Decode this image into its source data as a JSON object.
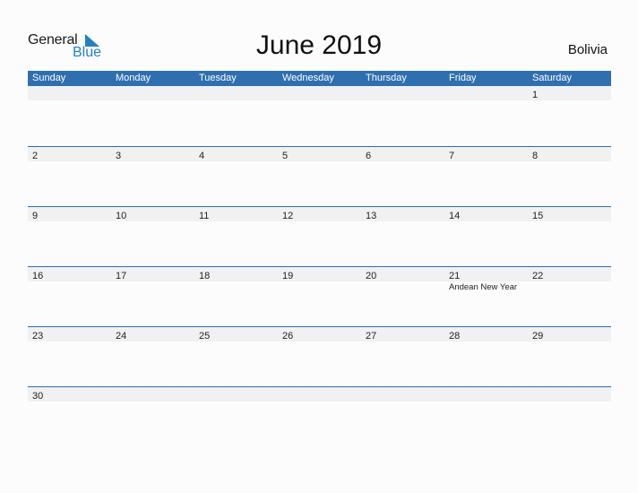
{
  "logo": {
    "word1": "General",
    "word2": "Blue"
  },
  "title": "June 2019",
  "country": "Bolivia",
  "colors": {
    "header_bg": "#2e6fb1",
    "accent": "#1f80c8",
    "date_strip": "#f1f1f1"
  },
  "weekdays": [
    "Sunday",
    "Monday",
    "Tuesday",
    "Wednesday",
    "Thursday",
    "Friday",
    "Saturday"
  ],
  "weeks": [
    {
      "days": [
        "",
        "",
        "",
        "",
        "",
        "",
        "1"
      ],
      "events": [
        "",
        "",
        "",
        "",
        "",
        "",
        ""
      ]
    },
    {
      "days": [
        "2",
        "3",
        "4",
        "5",
        "6",
        "7",
        "8"
      ],
      "events": [
        "",
        "",
        "",
        "",
        "",
        "",
        ""
      ]
    },
    {
      "days": [
        "9",
        "10",
        "11",
        "12",
        "13",
        "14",
        "15"
      ],
      "events": [
        "",
        "",
        "",
        "",
        "",
        "",
        ""
      ]
    },
    {
      "days": [
        "16",
        "17",
        "18",
        "19",
        "20",
        "21",
        "22"
      ],
      "events": [
        "",
        "",
        "",
        "",
        "",
        "Andean New Year",
        ""
      ]
    },
    {
      "days": [
        "23",
        "24",
        "25",
        "26",
        "27",
        "28",
        "29"
      ],
      "events": [
        "",
        "",
        "",
        "",
        "",
        "",
        ""
      ]
    },
    {
      "days": [
        "30",
        "",
        "",
        "",
        "",
        "",
        ""
      ],
      "events": [
        "",
        "",
        "",
        "",
        "",
        "",
        ""
      ]
    }
  ]
}
